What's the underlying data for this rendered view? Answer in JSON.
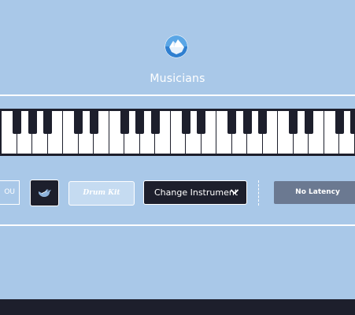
{
  "room": {
    "title": "Musicians",
    "logo_icon": "iceberg-globe-icon"
  },
  "keyboard": {
    "visible_white_keys": 23
  },
  "controls": {
    "left_partial_label": "OU",
    "bird_button_icon": "bird-icon",
    "drum_kit_label": "Drum Kit",
    "change_instrument_label": "Change Instrument",
    "change_instrument_icon": "chevron-down-icon",
    "no_latency_label": "No Latency"
  },
  "colors": {
    "background": "#a9c8e8",
    "dark": "#1d1f2c",
    "drum_kit_bg": "#c5dbf1",
    "no_latency_bg": "#6b7991"
  }
}
